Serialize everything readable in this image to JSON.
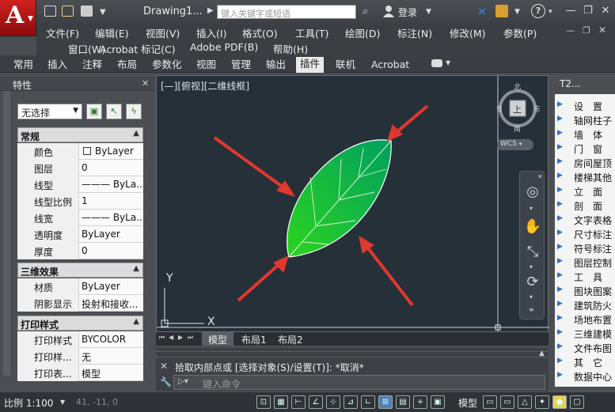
{
  "window": {
    "doc_title": "Drawing1...",
    "search_placeholder": "键入关键字或短语",
    "login": "登录",
    "help_arrow": "▾"
  },
  "menubar": {
    "row1": [
      "文件(F)",
      "编辑(E)",
      "视图(V)",
      "插入(I)",
      "格式(O)",
      "工具(T)",
      "绘图(D)",
      "标注(N)",
      "修改(M)",
      "参数(P)"
    ],
    "row2": [
      "窗口(W)",
      "Acrobat 标记(C)",
      "Adobe PDF(B)",
      "帮助(H)"
    ]
  },
  "ribbon": {
    "tabs": [
      "常用",
      "插入",
      "注释",
      "布局",
      "参数化",
      "视图",
      "管理",
      "输出",
      "插件",
      "联机",
      "Acrobat"
    ],
    "active_tab": "插件"
  },
  "properties": {
    "title": "特性",
    "selection": "无选择",
    "sections": [
      {
        "name": "常规",
        "rows": [
          {
            "key": "颜色",
            "value": "ByLayer"
          },
          {
            "key": "图层",
            "value": "0"
          },
          {
            "key": "线型",
            "value": "——— ByLa..."
          },
          {
            "key": "线型比例",
            "value": "1"
          },
          {
            "key": "线宽",
            "value": "——— ByLa..."
          },
          {
            "key": "透明度",
            "value": "ByLayer"
          },
          {
            "key": "厚度",
            "value": "0"
          }
        ]
      },
      {
        "name": "三维效果",
        "rows": [
          {
            "key": "材质",
            "value": "ByLayer"
          },
          {
            "key": "阴影显示",
            "value": "投射和接收..."
          }
        ]
      },
      {
        "name": "打印样式",
        "rows": [
          {
            "key": "打印样式",
            "value": "BYCOLOR"
          },
          {
            "key": "打印样...",
            "value": "无"
          },
          {
            "key": "打印表...",
            "value": "模型"
          }
        ]
      }
    ]
  },
  "viewport": {
    "label": "[—][俯视][二维线框]",
    "viewcube": {
      "north": "北",
      "south": "南",
      "east": "东",
      "west": "西",
      "top": "上"
    },
    "wcs": "WCS",
    "ucs_y": "Y",
    "ucs_x": "X"
  },
  "layout_tabs": [
    "模型",
    "布局1",
    "布局2"
  ],
  "command": {
    "history": "拾取内部点或 [选择对象(S)/设置(T)]: *取消*",
    "placeholder": "键入命令"
  },
  "tpanel": {
    "title": "T2...",
    "items": [
      "设　置",
      "轴网柱子",
      "墙　体",
      "门　窗",
      "房间屋顶",
      "楼梯其他",
      "立　面",
      "剖　面",
      "文字表格",
      "尺寸标注",
      "符号标注",
      "图层控制",
      "工　具",
      "图块图案",
      "建筑防火",
      "场地布置",
      "三维建模",
      "文件布图",
      "其　它",
      "数据中心"
    ]
  },
  "statusbar": {
    "scale": "比例 1:100",
    "coords": "41, -11, 0",
    "model": "模型"
  },
  "colors": {
    "accent_red": "#e0382e",
    "leaf_dark": "#00a040",
    "leaf_light": "#2cd41e"
  }
}
